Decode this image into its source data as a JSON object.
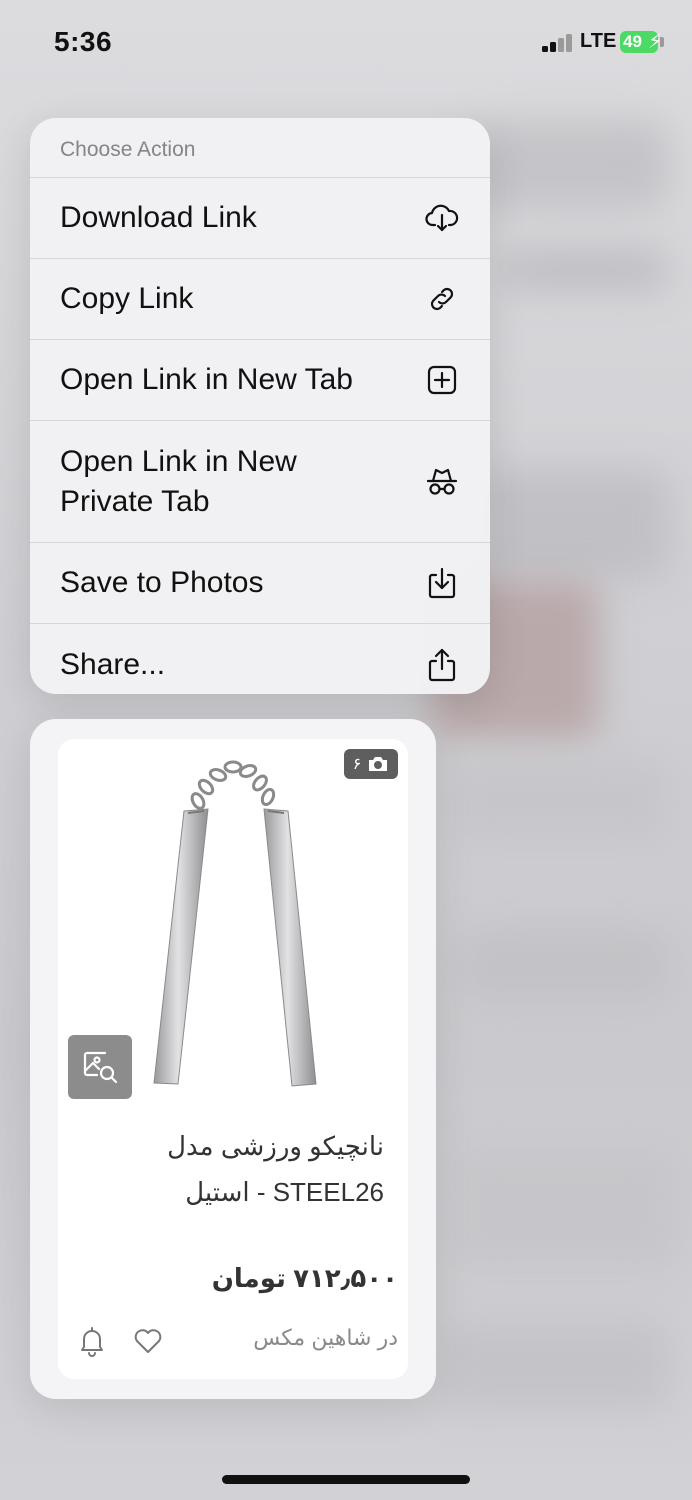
{
  "status_bar": {
    "time": "5:36",
    "network": "LTE",
    "battery": "49"
  },
  "menu": {
    "header": "Choose Action",
    "items": [
      {
        "label": "Download Link",
        "icon": "cloud-download-icon"
      },
      {
        "label": "Copy Link",
        "icon": "link-icon"
      },
      {
        "label": "Open Link in New Tab",
        "icon": "plus-square-icon"
      },
      {
        "label": "Open Link in New Private Tab",
        "icon": "incognito-icon"
      },
      {
        "label": "Save to Photos",
        "icon": "save-to-photos-icon"
      },
      {
        "label": "Share...",
        "icon": "share-icon"
      }
    ]
  },
  "product": {
    "photo_count": "۶",
    "title": "نانچیکو ورزشی مدل STEEL26 - استیل",
    "price": "۷۱۲٫۵۰۰ تومان",
    "seller": "در شاهین مکس"
  },
  "colors": {
    "menu_bg": "#f2f2f4",
    "battery": "#4cd964",
    "text": "#111111"
  }
}
